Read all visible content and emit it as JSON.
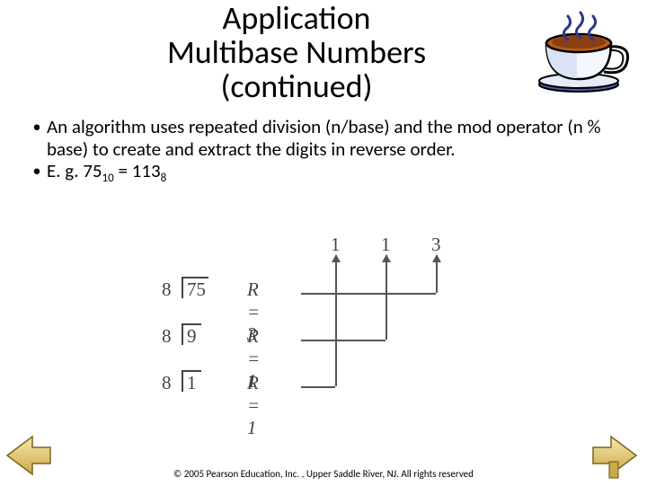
{
  "title": {
    "line1": "Application",
    "line2": "Multibase Numbers",
    "line3": "(continued)"
  },
  "bullets": [
    "An algorithm uses repeated division (n/base) and the mod operator (n % base) to create and extract the digits in reverse order.",
    "E. g.   75"
  ],
  "eg_sub1": "10",
  "eg_eq": " = 113",
  "eg_sub2": "8",
  "diagram": {
    "top_digits": [
      "1",
      "1",
      "3"
    ],
    "rows": [
      {
        "divisor": "8",
        "dividend": "75",
        "r_label": "R",
        "r_eq": " = 3"
      },
      {
        "divisor": "8",
        "dividend": "9",
        "r_label": "R",
        "r_eq": " = 1"
      },
      {
        "divisor": "8",
        "dividend": "1",
        "r_label": "R",
        "r_eq": " = 1"
      }
    ]
  },
  "footer": "© 2005 Pearson Education, Inc. , Upper Saddle River, NJ.  All rights reserved",
  "icons": {
    "teacup": "teacup-illustration",
    "prev": "previous-slide",
    "next": "next-slide"
  }
}
